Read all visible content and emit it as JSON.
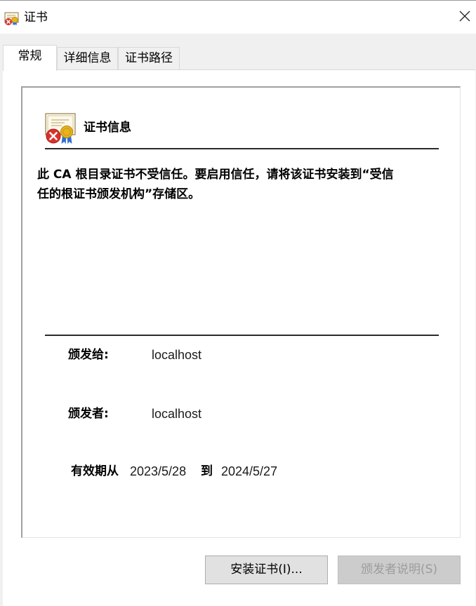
{
  "window": {
    "title": "证书",
    "icon": "certificate-icon",
    "close_icon": "close-icon"
  },
  "tabs": [
    {
      "label": "常规",
      "active": true
    },
    {
      "label": "详细信息",
      "active": false
    },
    {
      "label": "证书路径",
      "active": false
    }
  ],
  "info": {
    "icon": "certificate-error-icon",
    "heading": "证书信息",
    "warning_line1": "此 CA 根目录证书不受信任。要启用信任，请将该证书安装到“受信",
    "warning_line2": "任的根证书颁发机构”存储区。"
  },
  "fields": {
    "issued_to_label": "颁发给:",
    "issued_to_value": "localhost",
    "issued_by_label": "颁发者:",
    "issued_by_value": "localhost",
    "valid_from_label": "有效期从",
    "valid_from_value": "2023/5/28",
    "valid_to_label": "到",
    "valid_to_value": "2024/5/27"
  },
  "buttons": {
    "install": "安装证书(I)...",
    "issuer_statement": "颁发者说明(S)"
  },
  "colors": {
    "error_red": "#d9322b",
    "seal_gold": "#e8b41c",
    "ribbon_blue": "#2f6fd0"
  }
}
